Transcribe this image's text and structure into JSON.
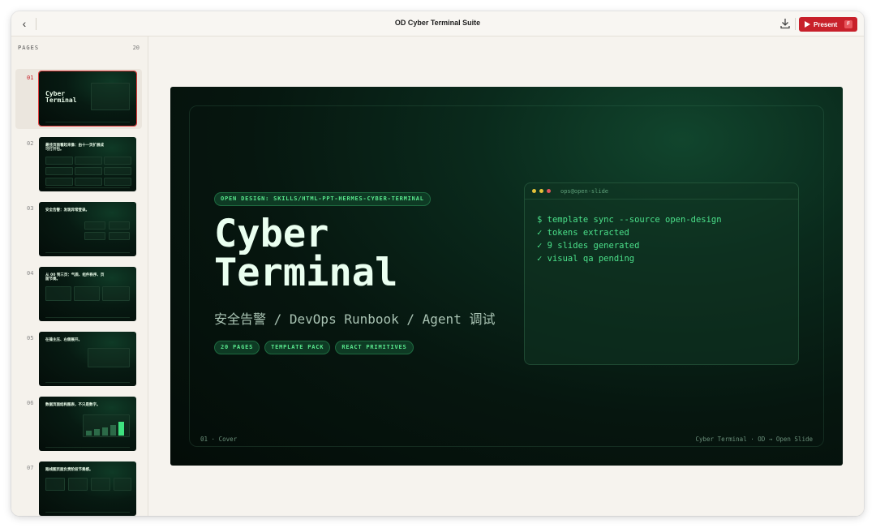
{
  "window": {
    "title": "OD Cyber Terminal Suite"
  },
  "toolbar": {
    "back_icon": "chevron-left-icon",
    "download_icon": "download-icon",
    "present_label": "Present",
    "present_shortcut": "F",
    "accent": "#c8202a"
  },
  "sidebar": {
    "pages_label": "PAGES",
    "pages_count": "20",
    "thumbs": [
      {
        "num": "01",
        "heading": "Cyber\nTerminal",
        "active": true
      },
      {
        "num": "02",
        "heading": "最佳页面看起来像：由十一页扩展成可打开包。"
      },
      {
        "num": "03",
        "heading": "安全告警：发现异常登录。"
      },
      {
        "num": "04",
        "heading": "从 00 到三页：气质、组件秩序、页面节奏。"
      },
      {
        "num": "05",
        "heading": "在操主压、右侧展开。"
      },
      {
        "num": "06",
        "heading": "数据页面结构图表，不只是数字。"
      },
      {
        "num": "07",
        "heading": "路线图页面负责阶段节奏感。"
      }
    ]
  },
  "slide": {
    "eyebrow": "OPEN DESIGN: SKILLS/HTML-PPT-HERMES-CYBER-TERMINAL",
    "title_line1": "Cyber",
    "title_line2": "Terminal",
    "subtitle": "安全告警 / DevOps Runbook / Agent 调试",
    "tags": [
      "20 PAGES",
      "TEMPLATE PACK",
      "REACT PRIMITIVES"
    ],
    "terminal": {
      "title": "ops@open-slide",
      "lines": [
        "$ template sync --source open-design",
        "✓ tokens extracted",
        "✓ 9 slides generated",
        "✓ visual qa pending"
      ],
      "dot_colors": [
        "#e5c23a",
        "#e5c23a",
        "#e0555c"
      ]
    },
    "footer_left": "01 · Cover",
    "footer_right": "Cyber Terminal · OD → Open Slide",
    "accent_green": "#4be08a"
  }
}
